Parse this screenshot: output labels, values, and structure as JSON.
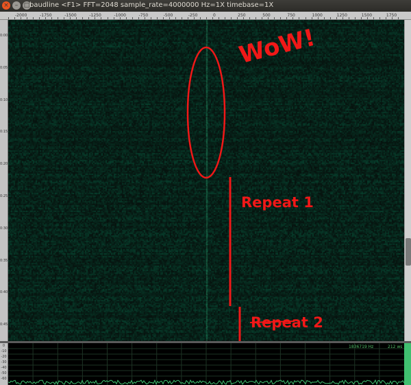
{
  "window": {
    "title": "baudline  <F1> FFT=2048 sample_rate=4000000 Hz=1X timebase=1X",
    "close_glyph": "×",
    "min_glyph": "–",
    "max_glyph": "□"
  },
  "ruler": {
    "labels": [
      "-2000",
      "-1750",
      "-1500",
      "-1250",
      "-1000",
      "-750",
      "-500",
      "-250",
      "0",
      "250",
      "500",
      "750",
      "1000",
      "1250",
      "1500",
      "1750"
    ]
  },
  "sidebar": {
    "labels": [
      "0:00",
      "0:05",
      "0:10",
      "0:15",
      "0:20",
      "0:25",
      "0:30",
      "0:35",
      "0:40",
      "0:45"
    ]
  },
  "spectrum": {
    "ylabels": [
      "0",
      "-10",
      "-20",
      "-30",
      "-40",
      "-50",
      "-60"
    ],
    "freq_readout": "1836719 Hz",
    "time_readout": "212 ws"
  },
  "annotations": {
    "wow": "WoW!",
    "repeat1": "Repeat 1",
    "repeat2": "Repeat 2"
  },
  "colors": {
    "annotation": "#f01818",
    "waterfall_bg": "#0a1f19",
    "signal": "#1f7a55"
  }
}
